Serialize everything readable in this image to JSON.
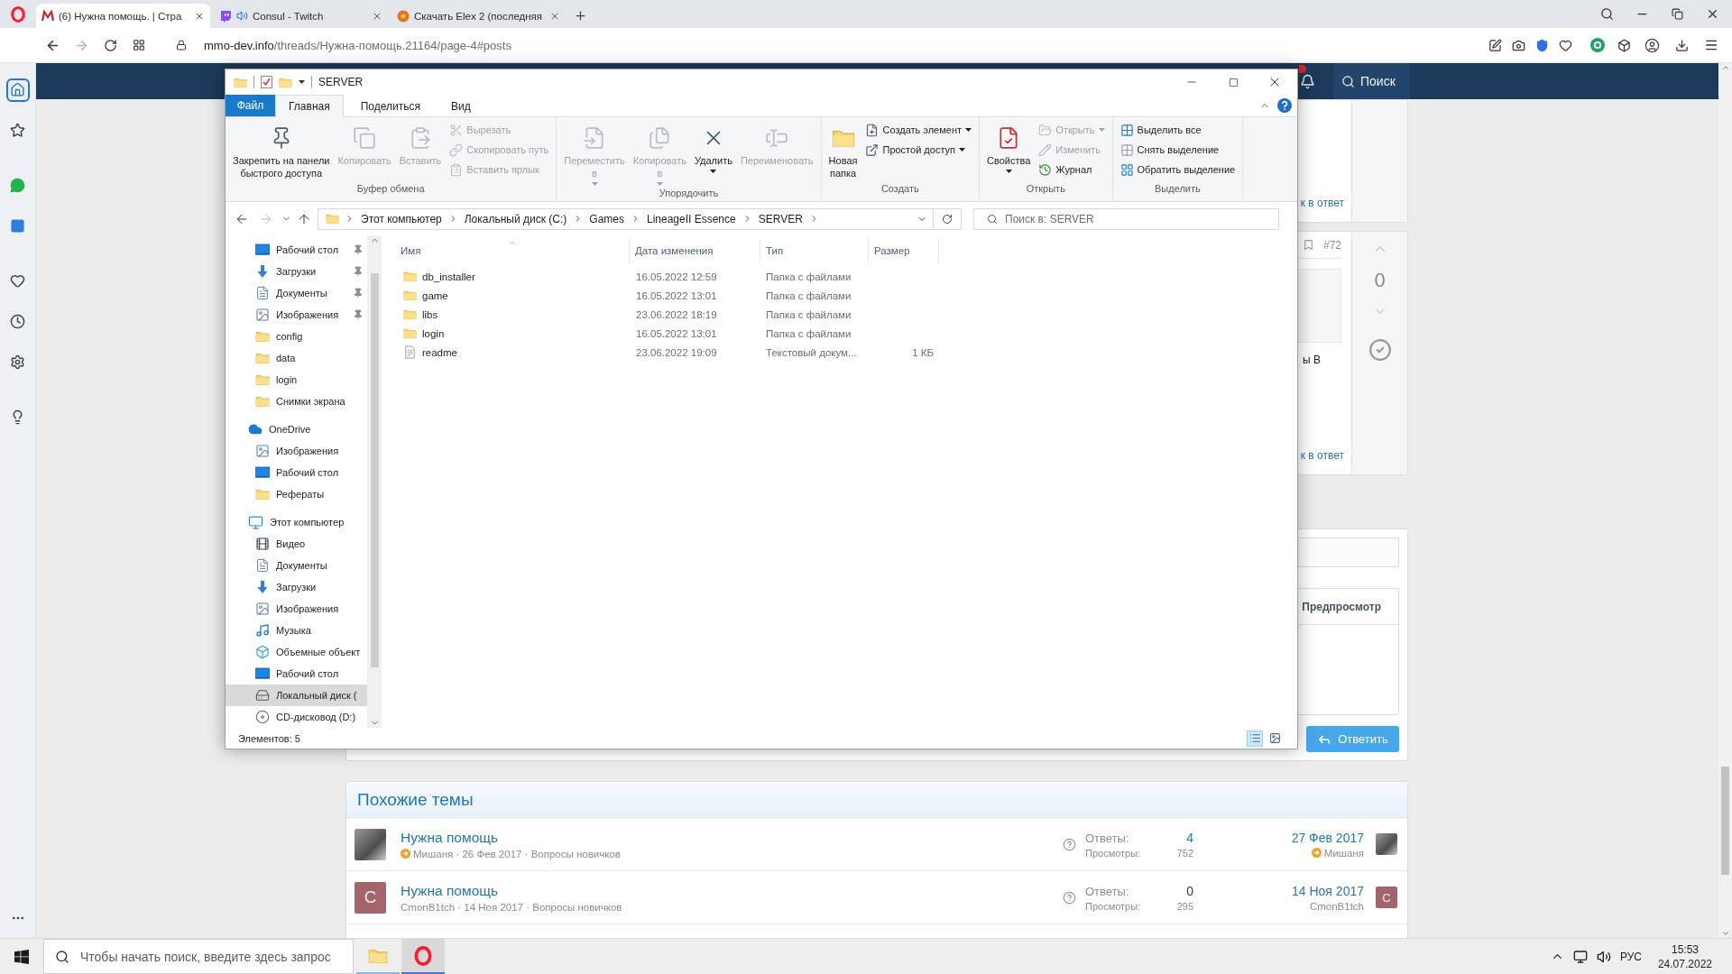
{
  "browser": {
    "tabs": [
      {
        "kind": "forum",
        "title": "(6) Нужна помощь. | Стра",
        "selected": true,
        "audio": false
      },
      {
        "kind": "twitch",
        "title": "Consul - Twitch",
        "selected": false,
        "audio": true
      },
      {
        "kind": "download",
        "title": "Скачать Elex 2 (последняя",
        "selected": false,
        "audio": false
      }
    ],
    "url": {
      "host": "mmo-dev.info",
      "path": "/threads/Нужна-помощь.21164/page-4#posts"
    }
  },
  "sidebar": {
    "groups": [
      {
        "items": [
          {
            "kind": "home",
            "selected": true
          },
          {
            "kind": "star",
            "selected": false
          }
        ]
      },
      {
        "items": [
          {
            "kind": "chat",
            "selected": false
          },
          {
            "kind": "square",
            "selected": false
          }
        ]
      },
      {
        "items": [
          {
            "kind": "heart",
            "selected": false
          },
          {
            "kind": "clock",
            "selected": false
          },
          {
            "kind": "settings",
            "selected": false
          }
        ]
      },
      {
        "items": [
          {
            "kind": "bulb",
            "selected": false
          }
        ]
      }
    ]
  },
  "forum": {
    "search": "Поиск",
    "posts": [
      {
        "link": "к в ответ"
      },
      {
        "number": "#72",
        "fragment": "ы В",
        "link": "к в ответ",
        "votes": "0"
      }
    ],
    "editor": {
      "preview_tab": "Предпросмотр",
      "submit": "Ответить"
    },
    "similar": {
      "title": "Похожие темы",
      "threads": [
        {
          "avatar": {
            "kind": "photo"
          },
          "title": "Нужна помощь",
          "author_badge": true,
          "meta": "Мишаня · 26 Фев 2017 · Вопросы новичков",
          "replies_label": "Ответы:",
          "replies": "4",
          "replies_link": true,
          "views_label": "Просмотры:",
          "views": "752",
          "last_date": "27 Фев 2017",
          "last_user": "Мишаня",
          "last_user_badge": true,
          "last_avatar": {
            "kind": "photo"
          }
        },
        {
          "avatar": {
            "kind": "letter",
            "letter": "C"
          },
          "title": "Нужна помощь",
          "author_badge": false,
          "meta": "CmonB1tch · 14 Ноя 2017 · Вопросы новичков",
          "replies_label": "Ответы:",
          "replies": "0",
          "replies_link": false,
          "views_label": "Просмотры:",
          "views": "295",
          "last_date": "14 Ноя 2017",
          "last_user": "CmonB1tch",
          "last_user_badge": false,
          "last_avatar": {
            "kind": "letter",
            "letter": "C"
          }
        }
      ]
    }
  },
  "explorer": {
    "title": "SERVER",
    "ribbon": {
      "tabs": [
        {
          "label": "Файл",
          "kind": "file",
          "selected": false
        },
        {
          "label": "Главная",
          "kind": "tab",
          "selected": true
        },
        {
          "label": "Поделиться",
          "kind": "tab",
          "selected": false
        },
        {
          "label": "Вид",
          "kind": "tab",
          "selected": false
        }
      ],
      "groups": [
        {
          "label": "Буфер обмена",
          "large": [
            {
              "kind": "pin",
              "label": "Закрепить на панели\nбыстрого доступа",
              "disabled": false,
              "dropdown": false
            },
            {
              "kind": "copy",
              "label": "Копировать",
              "disabled": true,
              "dropdown": false
            },
            {
              "kind": "paste",
              "label": "Вставить",
              "disabled": true,
              "dropdown": false
            }
          ],
          "small": [
            {
              "kind": "cut",
              "label": "Вырезать",
              "disabled": true,
              "dropdown": false
            },
            {
              "kind": "copy_path",
              "label": "Скопировать путь",
              "disabled": true,
              "dropdown": false
            },
            {
              "kind": "paste_shortcut",
              "label": "Вставить ярлык",
              "disabled": true,
              "dropdown": false
            }
          ]
        },
        {
          "label": "Упорядочить",
          "large": [
            {
              "kind": "move_to",
              "label": "Переместить\nв",
              "disabled": true,
              "dropdown": true
            },
            {
              "kind": "copy_to",
              "label": "Копировать\nв",
              "disabled": true,
              "dropdown": true
            },
            {
              "kind": "delete",
              "label": "Удалить",
              "disabled": false,
              "dropdown": true
            },
            {
              "kind": "rename",
              "label": "Переименовать",
              "disabled": true,
              "dropdown": false
            }
          ]
        },
        {
          "label": "Создать",
          "large": [
            {
              "kind": "new_folder",
              "label": "Новая\nпапка",
              "disabled": false,
              "dropdown": false
            }
          ],
          "small": [
            {
              "kind": "new_item",
              "label": "Создать элемент",
              "disabled": false,
              "dropdown": true
            },
            {
              "kind": "easy_access",
              "label": "Простой доступ",
              "disabled": false,
              "dropdown": true
            }
          ]
        },
        {
          "label": "Открыть",
          "large": [
            {
              "kind": "properties",
              "label": "Свойства",
              "disabled": false,
              "dropdown": true
            }
          ],
          "small": [
            {
              "kind": "open",
              "label": "Открыть",
              "disabled": true,
              "dropdown": true
            },
            {
              "kind": "edit",
              "label": "Изменить",
              "disabled": true,
              "dropdown": false
            },
            {
              "kind": "history",
              "label": "Журнал",
              "disabled": false,
              "dropdown": false
            }
          ]
        },
        {
          "label": "Выделить",
          "small": [
            {
              "kind": "select_all",
              "label": "Выделить все",
              "disabled": false,
              "dropdown": false
            },
            {
              "kind": "select_none",
              "label": "Снять выделение",
              "disabled": false,
              "dropdown": false
            },
            {
              "kind": "invert_selection",
              "label": "Обратить выделение",
              "disabled": false,
              "dropdown": false
            }
          ]
        }
      ]
    },
    "address": {
      "back": {
        "disabled": false
      },
      "forward": {
        "disabled": true
      },
      "breadcrumbs": [
        "Этот компьютер",
        "Локальный диск (C:)",
        "Games",
        "LineageII Essence",
        "SERVER"
      ],
      "search_placeholder": "Поиск в: SERVER"
    },
    "nav_pane": {
      "tree": [
        {
          "children": [
            {
              "kind": "desktop",
              "label": "Рабочий стол",
              "pinned": true,
              "selected": false
            },
            {
              "kind": "downloads",
              "label": "Загрузки",
              "pinned": true,
              "selected": false
            },
            {
              "kind": "documents",
              "label": "Документы",
              "pinned": true,
              "selected": false
            },
            {
              "kind": "pictures",
              "label": "Изображения",
              "pinned": true,
              "selected": false
            },
            {
              "kind": "folder",
              "label": "config",
              "pinned": false,
              "selected": false
            },
            {
              "kind": "folder",
              "label": "data",
              "pinned": false,
              "selected": false
            },
            {
              "kind": "folder",
              "label": "login",
              "pinned": false,
              "selected": false
            },
            {
              "kind": "folder",
              "label": "Снимки экрана",
              "pinned": false,
              "selected": false
            }
          ]
        },
        {
          "kind": "cloud",
          "label": "OneDrive",
          "selected": false,
          "children": [
            {
              "kind": "pictures",
              "label": "Изображения",
              "selected": false
            },
            {
              "kind": "desktop",
              "label": "Рабочий стол",
              "selected": false
            },
            {
              "kind": "folder",
              "label": "Рефераты",
              "selected": false
            }
          ]
        },
        {
          "kind": "computer",
          "label": "Этот компьютер",
          "selected": false,
          "children": [
            {
              "kind": "video",
              "label": "Видео",
              "selected": false
            },
            {
              "kind": "documents",
              "label": "Документы",
              "selected": false
            },
            {
              "kind": "downloads",
              "label": "Загрузки",
              "selected": false
            },
            {
              "kind": "pictures",
              "label": "Изображения",
              "selected": false
            },
            {
              "kind": "music",
              "label": "Музыка",
              "selected": false
            },
            {
              "kind": "objects",
              "label": "Объемные объект",
              "selected": false
            },
            {
              "kind": "desktop",
              "label": "Рабочий стол",
              "selected": false
            },
            {
              "kind": "drive",
              "label": "Локальный диск (",
              "selected": true
            },
            {
              "kind": "cd",
              "label": "CD-дисковод (D:)",
              "selected": false
            }
          ]
        }
      ]
    },
    "columns": [
      {
        "label": "Имя",
        "sorted": true
      },
      {
        "label": "Дата изменения",
        "sorted": false
      },
      {
        "label": "Тип",
        "sorted": false
      },
      {
        "label": "Размер",
        "sorted": false
      }
    ],
    "files": [
      {
        "kind": "folder",
        "name": "db_installer",
        "modified": "16.05.2022 12:59",
        "type": "Папка с файлами",
        "selected": false
      },
      {
        "kind": "folder",
        "name": "game",
        "modified": "16.05.2022 13:01",
        "type": "Папка с файлами",
        "selected": false
      },
      {
        "kind": "folder",
        "name": "libs",
        "modified": "23.06.2022 18:19",
        "type": "Папка с файлами",
        "selected": false
      },
      {
        "kind": "folder",
        "name": "login",
        "modified": "16.05.2022 13:01",
        "type": "Папка с файлами",
        "selected": false
      },
      {
        "kind": "text",
        "name": "readme",
        "modified": "23.06.2022 19:09",
        "type": "Текстовый докум...",
        "size": "1 КБ",
        "selected": false
      }
    ],
    "status": {
      "items_count": "Элементов: 5",
      "view_modes": [
        {
          "kind": "details",
          "selected": true
        },
        {
          "kind": "large_icons",
          "selected": false
        }
      ]
    }
  },
  "taskbar": {
    "search_placeholder": "Чтобы начать поиск, введите здесь запрос",
    "apps": [
      {
        "kind": "explorer",
        "active": false
      },
      {
        "kind": "browser",
        "active": true
      }
    ],
    "language": "РУС",
    "time": "15:53",
    "date": "24.07.2022"
  }
}
